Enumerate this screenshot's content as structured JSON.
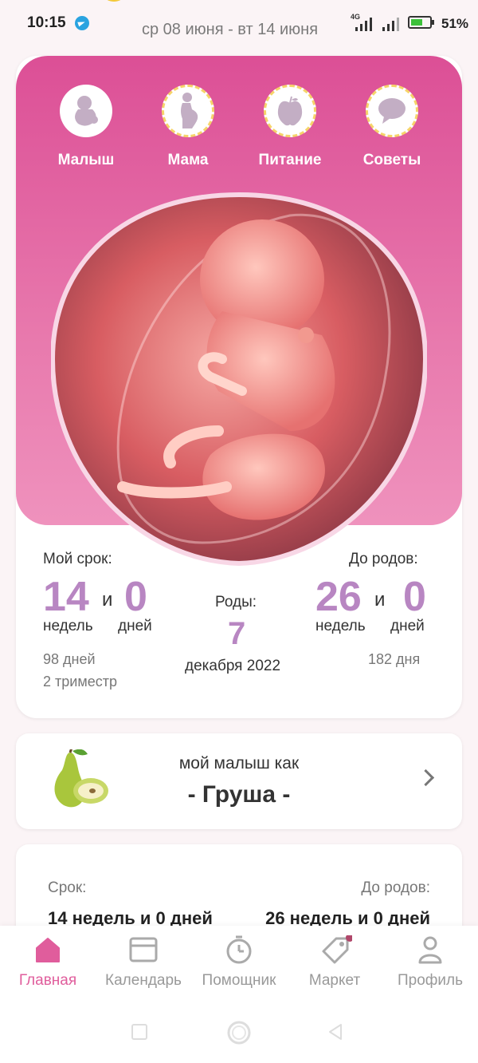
{
  "status": {
    "time": "10:15",
    "dates": "ср 08 июня - вт 14 июня",
    "network": "4G",
    "battery": "51%"
  },
  "categories": [
    {
      "label": "Малыш",
      "icon": "baby-icon"
    },
    {
      "label": "Мама",
      "icon": "mother-icon"
    },
    {
      "label": "Питание",
      "icon": "apple-icon"
    },
    {
      "label": "Советы",
      "icon": "chat-bubble-icon"
    }
  ],
  "stats": {
    "my_term_label": "Мой срок:",
    "weeks": "14",
    "and": "и",
    "days": "0",
    "weeks_unit": "недель",
    "days_unit": "дней",
    "total_days": "98 дней",
    "trimester": "2 триместр",
    "birth_label": "Роды:",
    "birth_day": "7",
    "birth_month_year": "декабря 2022",
    "until_label": "До родов:",
    "until_weeks": "26",
    "until_days": "0",
    "until_total_days": "182 дня"
  },
  "baby_size": {
    "subtitle": "мой малыш как",
    "fruit": "- Груша -"
  },
  "summary": {
    "term_label": "Срок:",
    "term_value": "14 недель и 0 дней",
    "until_label": "До родов:",
    "until_value": "26 недель и 0 дней"
  },
  "nav": [
    {
      "label": "Главная",
      "active": true
    },
    {
      "label": "Календарь",
      "active": false
    },
    {
      "label": "Помощник",
      "active": false
    },
    {
      "label": "Маркет",
      "active": false
    },
    {
      "label": "Профиль",
      "active": false
    }
  ],
  "colors": {
    "accent": "#e05d9c",
    "numbers": "#b886c2",
    "hero_top": "#dc4f96",
    "hero_bottom": "#ef92bd"
  }
}
